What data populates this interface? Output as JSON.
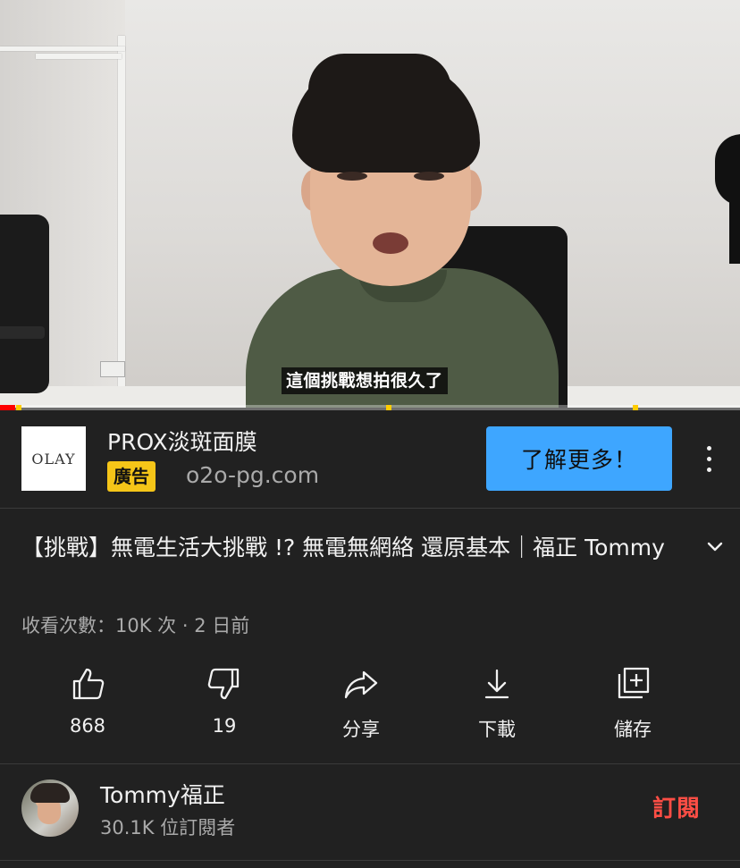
{
  "video": {
    "subtitle": "這個挑戰想拍很久了",
    "progress_fraction": 0.02,
    "ad_marker_fractions": [
      0.022,
      0.522,
      0.855
    ]
  },
  "ad": {
    "logo_text": "OLAY",
    "title": "PROX淡斑面膜",
    "badge": "廣告",
    "domain": "o2o-pg.com",
    "cta": "了解更多！"
  },
  "video_info": {
    "title": "【挑戰】無電生活大挑戰 !? 無電無網絡 還原基本｜福正 Tommy",
    "meta": "收看次數：10K 次 · 2 日前"
  },
  "actions": {
    "like_count": "868",
    "dislike_count": "19",
    "share_label": "分享",
    "download_label": "下載",
    "save_label": "儲存"
  },
  "channel": {
    "name": "Tommy福正",
    "subscribers": "30.1K 位訂閱者",
    "subscribe_label": "訂閱"
  },
  "colors": {
    "background": "#212121",
    "cta_blue": "#3ea6ff",
    "ad_badge": "#f5c518",
    "subscribe_red": "#ff4e45",
    "progress_red": "#ff0000"
  }
}
